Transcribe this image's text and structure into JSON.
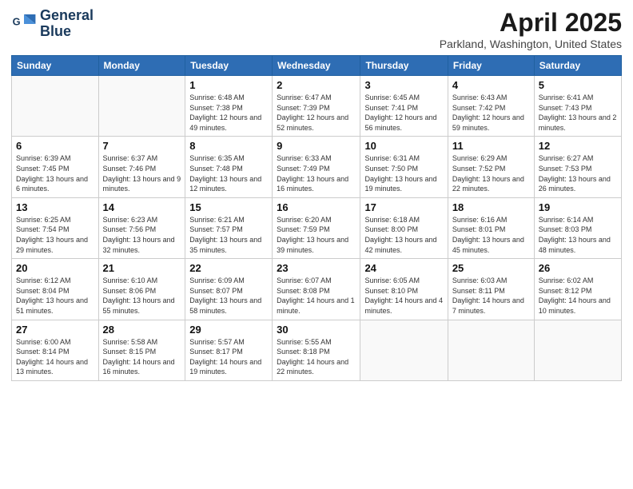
{
  "logo": {
    "line1": "General",
    "line2": "Blue"
  },
  "title": "April 2025",
  "subtitle": "Parkland, Washington, United States",
  "days_header": [
    "Sunday",
    "Monday",
    "Tuesday",
    "Wednesday",
    "Thursday",
    "Friday",
    "Saturday"
  ],
  "weeks": [
    [
      {
        "day": "",
        "info": ""
      },
      {
        "day": "",
        "info": ""
      },
      {
        "day": "1",
        "info": "Sunrise: 6:48 AM\nSunset: 7:38 PM\nDaylight: 12 hours and 49 minutes."
      },
      {
        "day": "2",
        "info": "Sunrise: 6:47 AM\nSunset: 7:39 PM\nDaylight: 12 hours and 52 minutes."
      },
      {
        "day": "3",
        "info": "Sunrise: 6:45 AM\nSunset: 7:41 PM\nDaylight: 12 hours and 56 minutes."
      },
      {
        "day": "4",
        "info": "Sunrise: 6:43 AM\nSunset: 7:42 PM\nDaylight: 12 hours and 59 minutes."
      },
      {
        "day": "5",
        "info": "Sunrise: 6:41 AM\nSunset: 7:43 PM\nDaylight: 13 hours and 2 minutes."
      }
    ],
    [
      {
        "day": "6",
        "info": "Sunrise: 6:39 AM\nSunset: 7:45 PM\nDaylight: 13 hours and 6 minutes."
      },
      {
        "day": "7",
        "info": "Sunrise: 6:37 AM\nSunset: 7:46 PM\nDaylight: 13 hours and 9 minutes."
      },
      {
        "day": "8",
        "info": "Sunrise: 6:35 AM\nSunset: 7:48 PM\nDaylight: 13 hours and 12 minutes."
      },
      {
        "day": "9",
        "info": "Sunrise: 6:33 AM\nSunset: 7:49 PM\nDaylight: 13 hours and 16 minutes."
      },
      {
        "day": "10",
        "info": "Sunrise: 6:31 AM\nSunset: 7:50 PM\nDaylight: 13 hours and 19 minutes."
      },
      {
        "day": "11",
        "info": "Sunrise: 6:29 AM\nSunset: 7:52 PM\nDaylight: 13 hours and 22 minutes."
      },
      {
        "day": "12",
        "info": "Sunrise: 6:27 AM\nSunset: 7:53 PM\nDaylight: 13 hours and 26 minutes."
      }
    ],
    [
      {
        "day": "13",
        "info": "Sunrise: 6:25 AM\nSunset: 7:54 PM\nDaylight: 13 hours and 29 minutes."
      },
      {
        "day": "14",
        "info": "Sunrise: 6:23 AM\nSunset: 7:56 PM\nDaylight: 13 hours and 32 minutes."
      },
      {
        "day": "15",
        "info": "Sunrise: 6:21 AM\nSunset: 7:57 PM\nDaylight: 13 hours and 35 minutes."
      },
      {
        "day": "16",
        "info": "Sunrise: 6:20 AM\nSunset: 7:59 PM\nDaylight: 13 hours and 39 minutes."
      },
      {
        "day": "17",
        "info": "Sunrise: 6:18 AM\nSunset: 8:00 PM\nDaylight: 13 hours and 42 minutes."
      },
      {
        "day": "18",
        "info": "Sunrise: 6:16 AM\nSunset: 8:01 PM\nDaylight: 13 hours and 45 minutes."
      },
      {
        "day": "19",
        "info": "Sunrise: 6:14 AM\nSunset: 8:03 PM\nDaylight: 13 hours and 48 minutes."
      }
    ],
    [
      {
        "day": "20",
        "info": "Sunrise: 6:12 AM\nSunset: 8:04 PM\nDaylight: 13 hours and 51 minutes."
      },
      {
        "day": "21",
        "info": "Sunrise: 6:10 AM\nSunset: 8:06 PM\nDaylight: 13 hours and 55 minutes."
      },
      {
        "day": "22",
        "info": "Sunrise: 6:09 AM\nSunset: 8:07 PM\nDaylight: 13 hours and 58 minutes."
      },
      {
        "day": "23",
        "info": "Sunrise: 6:07 AM\nSunset: 8:08 PM\nDaylight: 14 hours and 1 minute."
      },
      {
        "day": "24",
        "info": "Sunrise: 6:05 AM\nSunset: 8:10 PM\nDaylight: 14 hours and 4 minutes."
      },
      {
        "day": "25",
        "info": "Sunrise: 6:03 AM\nSunset: 8:11 PM\nDaylight: 14 hours and 7 minutes."
      },
      {
        "day": "26",
        "info": "Sunrise: 6:02 AM\nSunset: 8:12 PM\nDaylight: 14 hours and 10 minutes."
      }
    ],
    [
      {
        "day": "27",
        "info": "Sunrise: 6:00 AM\nSunset: 8:14 PM\nDaylight: 14 hours and 13 minutes."
      },
      {
        "day": "28",
        "info": "Sunrise: 5:58 AM\nSunset: 8:15 PM\nDaylight: 14 hours and 16 minutes."
      },
      {
        "day": "29",
        "info": "Sunrise: 5:57 AM\nSunset: 8:17 PM\nDaylight: 14 hours and 19 minutes."
      },
      {
        "day": "30",
        "info": "Sunrise: 5:55 AM\nSunset: 8:18 PM\nDaylight: 14 hours and 22 minutes."
      },
      {
        "day": "",
        "info": ""
      },
      {
        "day": "",
        "info": ""
      },
      {
        "day": "",
        "info": ""
      }
    ]
  ]
}
